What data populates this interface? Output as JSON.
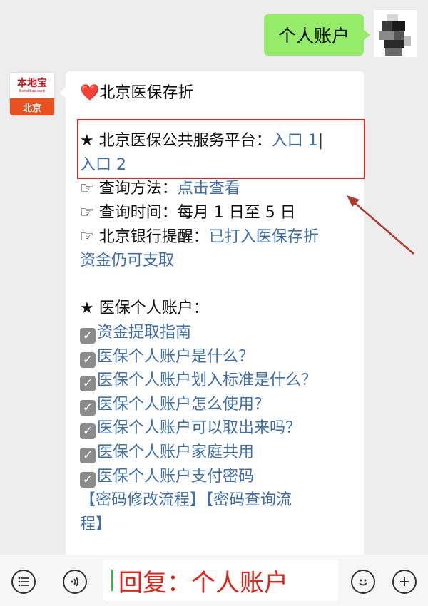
{
  "outgoing": {
    "text": "个人账户"
  },
  "bot": {
    "logo_cn": "本地宝",
    "logo_en": "Bendibao.com",
    "city": "北京"
  },
  "message": {
    "heart": "❤️",
    "title": "北京医保存折",
    "platform_label": "★ 北京医保公共服务平台：",
    "entry1": "入口 1",
    "entry2": "入口 2",
    "query_method_label": "☞ 查询方法：",
    "query_method_link": "点击查看",
    "query_time_label": "☞ 查询时间：",
    "query_time_value": "每月 1 日至 5 日",
    "bank_label": "☞ 北京银行提醒：",
    "bank_link_1": "已打入医保存折",
    "bank_link_2": "资金仍可支取",
    "account_header": "★ 医保个人账户：",
    "check_items": [
      "资金提取指南",
      "医保个人账户是什么？",
      "医保个人账户划入标准是什么？",
      "医保个人账户怎么使用？",
      "医保个人账户可以取出来吗？",
      "医保个人账户家庭共用",
      "医保个人账户支付密码"
    ],
    "password_links_1": "【密码修改流程】【密码查询流",
    "password_links_2": "程】"
  },
  "bottom": {
    "reply_text": "回复：个人账户",
    "icons": [
      "menu-icon",
      "voice-icon",
      "emoji-icon",
      "plus-icon"
    ]
  },
  "colors": {
    "link": "#3f6ea8",
    "highlight_border": "#c9302c",
    "reply_text": "#e2231a",
    "sent_bubble": "#95ec69"
  }
}
